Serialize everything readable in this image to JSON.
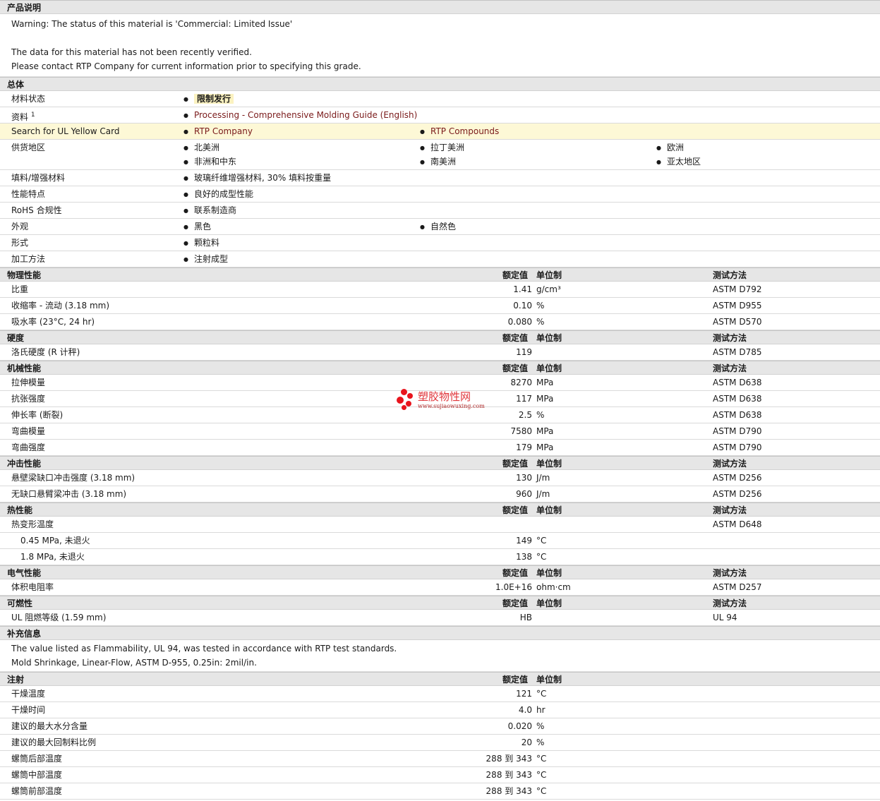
{
  "headers": {
    "value": "额定值",
    "unit": "单位制",
    "test": "测试方法"
  },
  "product_description": {
    "title": "产品说明",
    "lines": [
      "Warning: The status of this material is 'Commercial: Limited Issue'",
      "",
      "The data for this material has not been recently verified.",
      "Please contact RTP Company for current information prior to specifying this grade."
    ]
  },
  "general": {
    "title": "总体",
    "material_status": {
      "label": "材料状态",
      "value": "限制发行"
    },
    "documents": {
      "label": "资料",
      "sup": "1",
      "link": "Processing - Comprehensive Molding Guide (English)"
    },
    "ul_card": {
      "label": "Search for UL Yellow Card",
      "links": [
        "RTP Company",
        "RTP Compounds"
      ]
    },
    "regions": {
      "label": "供货地区",
      "items": [
        "北美洲",
        "拉丁美洲",
        "欧洲",
        "非洲和中东",
        "南美洲",
        "亚太地区"
      ]
    },
    "filler": {
      "label": "填料/增强材料",
      "value": "玻璃纤维增强材料, 30% 填料按重量"
    },
    "features": {
      "label": "性能特点",
      "value": "良好的成型性能"
    },
    "rohs": {
      "label": "RoHS 合规性",
      "value": "联系制造商"
    },
    "appearance": {
      "label": "外观",
      "values": [
        "黑色",
        "自然色"
      ]
    },
    "form": {
      "label": "形式",
      "value": "颗粒料"
    },
    "processing": {
      "label": "加工方法",
      "value": "注射成型"
    }
  },
  "physical": {
    "title": "物理性能",
    "rows": [
      {
        "label": "比重",
        "value": "1.41",
        "unit": "g/cm³",
        "test": "ASTM D792"
      },
      {
        "label": "收缩率  - 流动  (3.18 mm)",
        "value": "0.10",
        "unit": "%",
        "test": "ASTM D955"
      },
      {
        "label": "吸水率  (23°C, 24 hr)",
        "value": "0.080",
        "unit": "%",
        "test": "ASTM D570"
      }
    ]
  },
  "hardness": {
    "title": "硬度",
    "rows": [
      {
        "label": "洛氏硬度  (R 计秤)",
        "value": "119",
        "unit": "",
        "test": "ASTM D785"
      }
    ]
  },
  "mechanical": {
    "title": "机械性能",
    "rows": [
      {
        "label": "拉伸模量",
        "value": "8270",
        "unit": "MPa",
        "test": "ASTM D638"
      },
      {
        "label": "抗张强度",
        "value": "117",
        "unit": "MPa",
        "test": "ASTM D638"
      },
      {
        "label": "伸长率  (断裂)",
        "value": "2.5",
        "unit": "%",
        "test": "ASTM D638"
      },
      {
        "label": "弯曲模量",
        "value": "7580",
        "unit": "MPa",
        "test": "ASTM D790"
      },
      {
        "label": "弯曲强度",
        "value": "179",
        "unit": "MPa",
        "test": "ASTM D790"
      }
    ]
  },
  "impact": {
    "title": "冲击性能",
    "rows": [
      {
        "label": "悬壁梁缺口冲击强度  (3.18 mm)",
        "value": "130",
        "unit": "J/m",
        "test": "ASTM D256"
      },
      {
        "label": "无缺口悬臂梁冲击  (3.18 mm)",
        "value": "960",
        "unit": "J/m",
        "test": "ASTM D256"
      }
    ]
  },
  "thermal": {
    "title": "热性能",
    "rows": [
      {
        "label": "热变形温度",
        "value": "",
        "unit": "",
        "test": "ASTM D648"
      },
      {
        "label": "0.45 MPa, 未退火",
        "value": "149",
        "unit": "°C",
        "test": ""
      },
      {
        "label": "1.8 MPa, 未退火",
        "value": "138",
        "unit": "°C",
        "test": ""
      }
    ]
  },
  "electrical": {
    "title": "电气性能",
    "rows": [
      {
        "label": "体积电阻率",
        "value": "1.0E+16",
        "unit": "ohm·cm",
        "test": "ASTM D257"
      }
    ]
  },
  "flammability": {
    "title": "可燃性",
    "rows": [
      {
        "label": "UL 阻燃等级  (1.59 mm)",
        "value": "HB",
        "unit": "",
        "test": "UL 94"
      }
    ]
  },
  "supplemental": {
    "title": "补充信息",
    "lines": [
      "The value listed as Flammability, UL 94, was tested in accordance with RTP test standards.",
      "Mold Shrinkage, Linear-Flow, ASTM D-955, 0.25in: 2mil/in."
    ]
  },
  "injection": {
    "title": "注射",
    "rows": [
      {
        "label": "干燥温度",
        "value": "121",
        "unit": "°C"
      },
      {
        "label": "干燥时间",
        "value": "4.0",
        "unit": "hr"
      },
      {
        "label": "建议的最大水分含量",
        "value": "0.020",
        "unit": "%"
      },
      {
        "label": "建议的最大回制料比例",
        "value": "20",
        "unit": "%"
      },
      {
        "label": "螺筒后部温度",
        "value": "288 到  343",
        "unit": "°C"
      },
      {
        "label": "螺筒中部温度",
        "value": "288 到  343",
        "unit": "°C"
      },
      {
        "label": "螺筒前部温度",
        "value": "288 到  343",
        "unit": "°C"
      }
    ]
  },
  "watermark": {
    "title": "塑胶物性网",
    "url": "www.sujiaowuxing.com"
  }
}
